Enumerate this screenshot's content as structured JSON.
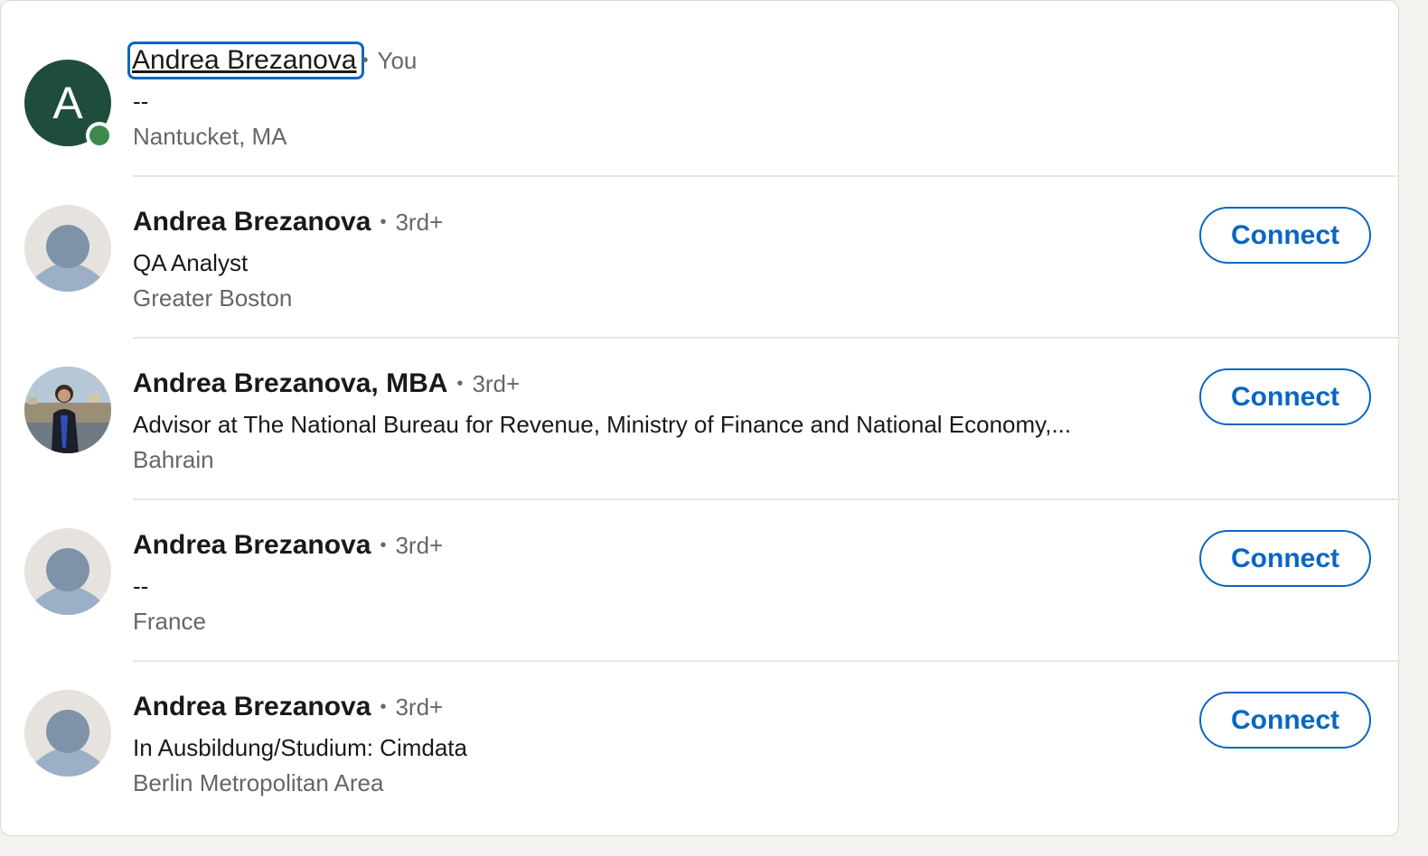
{
  "results": [
    {
      "name": "Andrea Brezanova",
      "degree": "You",
      "headline": "--",
      "location": "Nantucket, MA",
      "avatar_letter": "A",
      "avatar_type": "letter",
      "online": true
    },
    {
      "name": "Andrea Brezanova",
      "degree": "3rd+",
      "headline": "QA Analyst",
      "location": "Greater Boston",
      "avatar_type": "ghost",
      "action_label": "Connect"
    },
    {
      "name": "Andrea Brezanova, MBA",
      "degree": "3rd+",
      "headline": "Advisor at The National Bureau for Revenue, Ministry of Finance and National Economy,...",
      "location": "Bahrain",
      "avatar_type": "photo",
      "action_label": "Connect"
    },
    {
      "name": "Andrea Brezanova",
      "degree": "3rd+",
      "headline": "--",
      "location": "France",
      "avatar_type": "ghost",
      "action_label": "Connect"
    },
    {
      "name": "Andrea Brezanova",
      "degree": "3rd+",
      "headline": "In Ausbildung/Studium: Cimdata",
      "location": "Berlin Metropolitan Area",
      "avatar_type": "ghost",
      "action_label": "Connect"
    }
  ],
  "separator": "•",
  "colors": {
    "accent": "#0a66c2",
    "avatar_letter_bg": "#1e4d3c",
    "online": "#3d8a4a"
  },
  "icons": {
    "ghost_avatar": "person-silhouette-icon",
    "online_indicator": "online-status-icon"
  }
}
